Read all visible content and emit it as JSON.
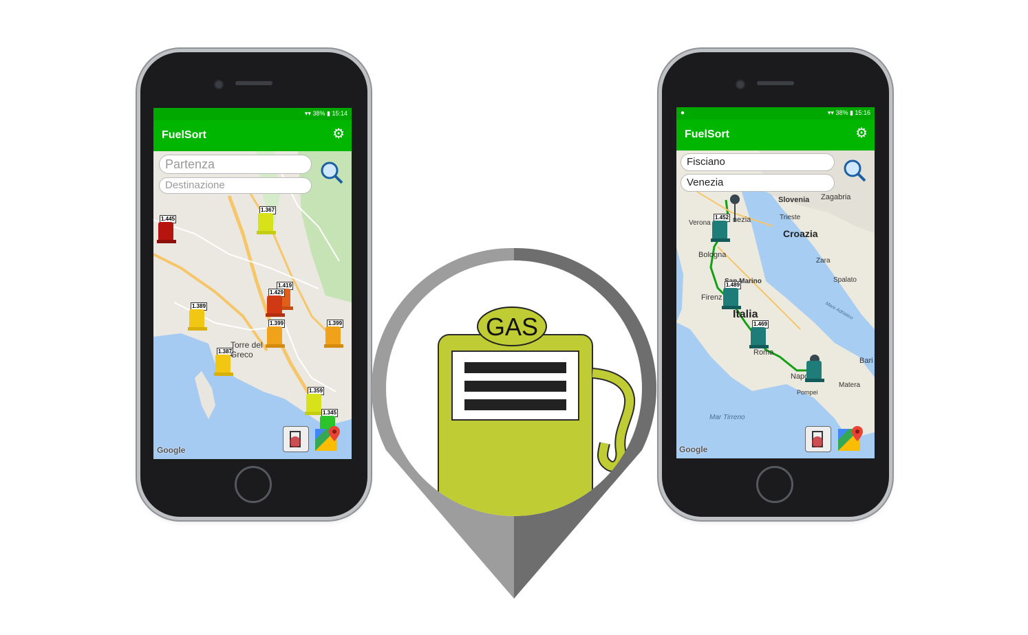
{
  "left_phone": {
    "status": {
      "battery": "38%",
      "time": "15:14"
    },
    "app_title": "FuelSort",
    "start_placeholder": "Partenza",
    "dest_placeholder": "Destinazione",
    "prices": [
      "1.445",
      "1.367",
      "1.419",
      "1.429",
      "1.389",
      "1.399",
      "1.399",
      "1.387",
      "1.359",
      "1.345"
    ],
    "place_label": "Torre del Greco",
    "google": "Google"
  },
  "right_phone": {
    "status": {
      "battery": "38%",
      "time": "15:16"
    },
    "app_title": "FuelSort",
    "start_value": "Fisciano",
    "dest_value": "Venezia",
    "prices": [
      "1.452",
      "1.489",
      "1.469"
    ],
    "labels": {
      "slovenia": "Slovenia",
      "zagabria": "Zagabria",
      "verona": "Verona",
      "venezia": "nezia",
      "trieste": "Trieste",
      "croazia": "Croazia",
      "bologna": "Bologna",
      "zara": "Zara",
      "sanmarino": "San Marino",
      "spalato": "Spalato",
      "firenze": "Firenz",
      "italia": "Italia",
      "roma": "Roma",
      "bari": "Bari",
      "napoli": "Napo",
      "matera": "Matera",
      "pompei": "Pompei",
      "tirreno": "Mar Tirreno",
      "adriatico": "Mare Adriatico"
    },
    "google": "Google"
  },
  "logo": {
    "badge_text": "GAS"
  },
  "colors": {
    "appbar": "#00b600",
    "statusbar": "#00a800",
    "pump": "#bfcc34",
    "route": "#14a014"
  }
}
